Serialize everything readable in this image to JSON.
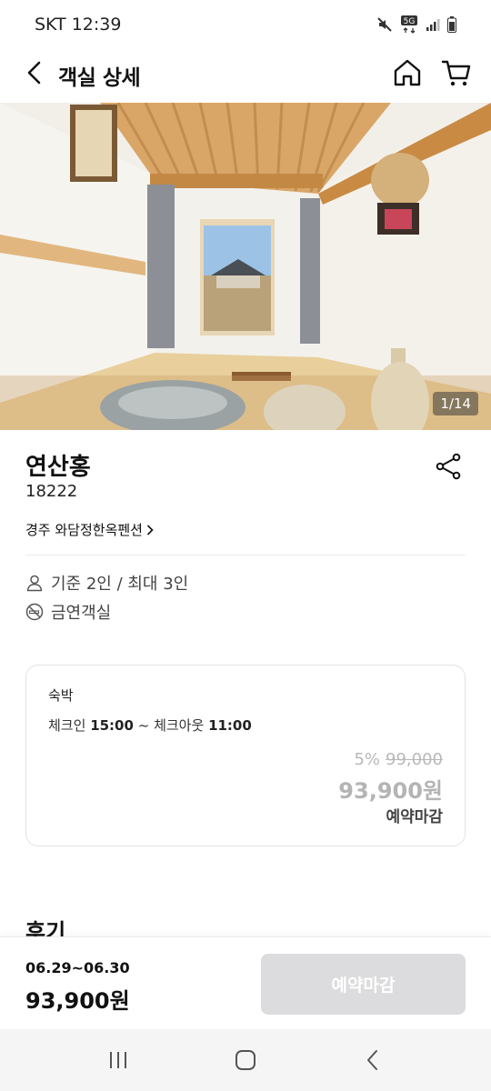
{
  "status_bar": {
    "carrier_time": "SKT 12:39",
    "network": "5G"
  },
  "header": {
    "title": "객실 상세",
    "back_icon": "chevron-left-icon",
    "home_icon": "home-icon",
    "cart_icon": "cart-icon"
  },
  "photo": {
    "counter": "1/14"
  },
  "room": {
    "name": "연산홍",
    "code": "18222",
    "pension_name": "경주 와담정한옥펜션",
    "capacity": "기준 2인 / 최대 3인",
    "smoking": "금연객실"
  },
  "stay": {
    "type": "숙박",
    "checkin_label": "체크인",
    "checkin_time": "15:00",
    "separator": "~",
    "checkout_label": "체크아웃",
    "checkout_time": "11:00",
    "discount_rate": "5%",
    "original_price": "99,000",
    "price": "93,900원",
    "status": "예약마감"
  },
  "reviews": {
    "heading": "후기"
  },
  "booking": {
    "dates": "06.29~06.30",
    "price": "93,900원",
    "button_label": "예약마감"
  },
  "colors": {
    "accent_disabled": "#dcdcde",
    "muted_price": "#b4b4b4"
  }
}
